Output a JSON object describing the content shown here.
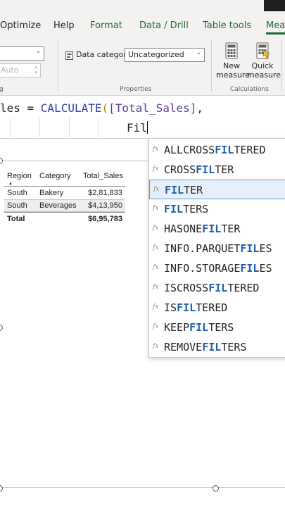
{
  "ribbon_tabs": [
    {
      "label": "Optimize"
    },
    {
      "label": "Help"
    },
    {
      "label": "Format"
    },
    {
      "label": "Data / Drill"
    },
    {
      "label": "Table tools"
    },
    {
      "label": "Meas"
    }
  ],
  "ribbon": {
    "autosize_placeholder": "Auto",
    "data_category_label": "Data category",
    "data_category_value": "Uncategorized",
    "properties_group": "Properties",
    "calculations_group": "Calculations",
    "new_measure_label_1": "New",
    "new_measure_label_2": "measure",
    "quick_measure_label_1": "Quick",
    "quick_measure_label_2": "measure",
    "left_group_label": "g"
  },
  "formula": {
    "line1_prefix": "les = ",
    "line1_fn": "CALCULATE",
    "line1_open": "(",
    "line1_measure": "[Total_Sales]",
    "line1_comma": ",",
    "line2_text": "Fil"
  },
  "table": {
    "headers": [
      "Region",
      "Category",
      "Total_Sales"
    ],
    "rows": [
      {
        "region": "South",
        "category": "Bakery",
        "total": "$2,81,833"
      },
      {
        "region": "South",
        "category": "Beverages",
        "total": "$4,13,950"
      }
    ],
    "total_label": "Total",
    "total_value": "$6,95,783"
  },
  "autocomplete": {
    "fx_icon": "fx",
    "items": [
      {
        "pre": "ALLCROSS",
        "match": "FIL",
        "post": "TERED"
      },
      {
        "pre": "CROSS",
        "match": "FIL",
        "post": "TER"
      },
      {
        "pre": "",
        "match": "FIL",
        "post": "TER"
      },
      {
        "pre": "",
        "match": "FIL",
        "post": "TERS"
      },
      {
        "pre": "HASONE",
        "match": "FIL",
        "post": "TER"
      },
      {
        "pre": "INFO.PARQUET",
        "match": "FIL",
        "post": "ES"
      },
      {
        "pre": "INFO.STORAGE",
        "match": "FIL",
        "post": "ES"
      },
      {
        "pre": "ISCROSS",
        "match": "FIL",
        "post": "TERED"
      },
      {
        "pre": "IS",
        "match": "FIL",
        "post": "TERED"
      },
      {
        "pre": "KEEP",
        "match": "FIL",
        "post": "TERS"
      },
      {
        "pre": "REMOVE",
        "match": "FIL",
        "post": "TERS"
      }
    ],
    "selected_index": 2
  },
  "colors": {
    "accent_green": "#1e6b35",
    "match_blue": "#1e5fa8",
    "selection_bg": "#e6f0fa"
  }
}
